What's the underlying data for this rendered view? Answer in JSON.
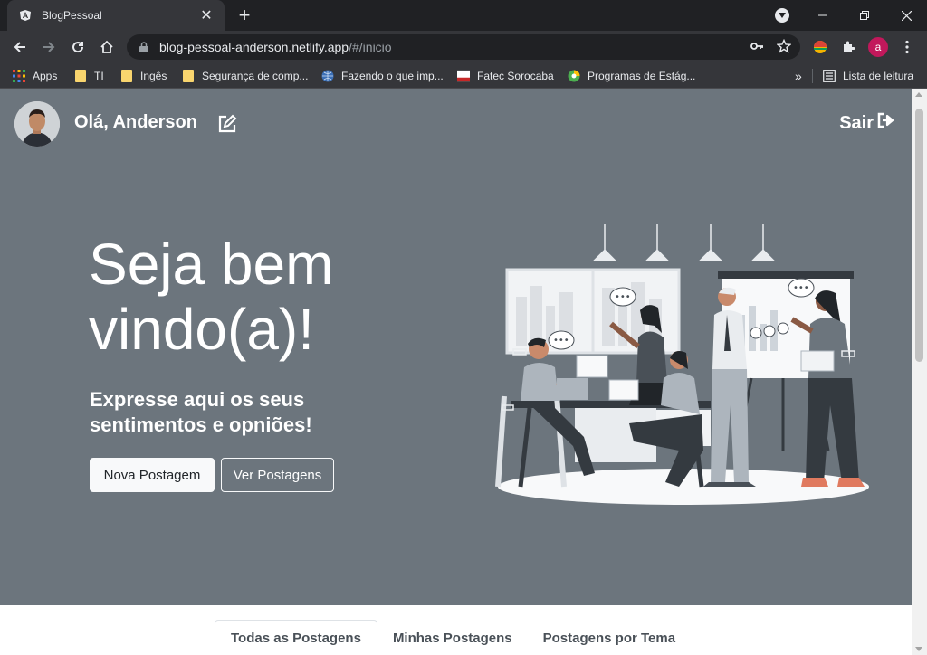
{
  "browser": {
    "tab_title": "BlogPessoal",
    "url_host": "blog-pessoal-anderson.netlify.app",
    "url_path": "/#/inicio",
    "profile_initial": "a",
    "bookmarks": [
      "Apps",
      "TI",
      "Ingês",
      "Segurança de comp...",
      "Fazendo o que imp...",
      "Fatec Sorocaba",
      "Programas de Estág..."
    ],
    "reading_list": "Lista de leitura",
    "more_bookmarks": "»"
  },
  "header": {
    "greeting": "Olá, Anderson",
    "logout_label": "Sair"
  },
  "hero": {
    "title": "Seja bem vindo(a)!",
    "subtitle": "Expresse aqui os seus sentimentos e opniões!",
    "new_post_button": "Nova Postagem",
    "view_posts_button": "Ver Postagens"
  },
  "tabs": {
    "items": [
      "Todas as Postagens",
      "Minhas Postagens",
      "Postagens por Tema"
    ],
    "active_index": 0
  },
  "colors": {
    "hero_background": "#6c757d",
    "browser_frame": "#202124",
    "profile_avatar": "#c2185b"
  },
  "icons": {
    "favicon": "angular-icon",
    "edit": "pencil-square-icon",
    "logout": "sign-out-icon"
  }
}
